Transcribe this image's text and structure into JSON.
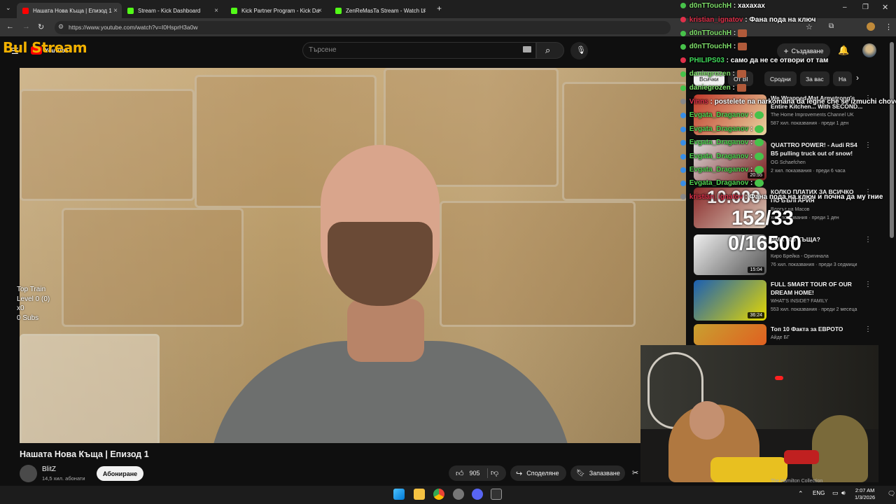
{
  "browser": {
    "tabs": [
      {
        "label": "Нашата Нова Къща | Епизод 1",
        "icon_color": "#ff0000"
      },
      {
        "label": "Stream - Kick Dashboard",
        "icon_color": "#53fc18"
      },
      {
        "label": "Kick Partner Program - Kick Da",
        "icon_color": "#53fc18"
      },
      {
        "label": "ZenReMasTa Stream - Watch Li",
        "icon_color": "#53fc18"
      }
    ],
    "url": "https://www.youtube.com/watch?v=I0HsprH3a0w"
  },
  "youtube": {
    "logo_overlay": "Bul  Stream",
    "logo_word": "YouTube",
    "search_placeholder": "Търсене",
    "create_label": "Създаване",
    "video": {
      "title": "Нашата Нова Къща | Епизод 1",
      "channel": "BlitZ",
      "subscribers": "14,5 хил. абонати",
      "subscribe_label": "Абониране",
      "likes": "905",
      "share_label": "Споделяне",
      "save_label": "Запазване"
    },
    "chips": [
      "Всички",
      "От Bl",
      "Сродни",
      "За вас",
      "На"
    ],
    "recommendations": [
      {
        "title": "We Wrapped Mat Armstrong's Entire Kitchen... With SECOND...",
        "channel": "The Home Improvements Channel UK",
        "meta": "587 хил. показвания · преди 1 ден",
        "duration": ""
      },
      {
        "title": "QUATTRO POWER! - Audi RS4 B5 pulling truck out of snow!",
        "channel": "OG Schaefchen",
        "meta": "2 хил. показвания · преди 6 часа",
        "duration": "20:55"
      },
      {
        "title": "КОЛКО ПЛАТИХ ЗА ВСИЧКО ПО БЪЛГАРИЯ",
        "channel": "Влогът на Масов",
        "meta": "хил. показвания · преди 1 ден",
        "duration": ""
      },
      {
        "title": "ИМА 800 КЪЩА?",
        "channel": "Киро Брейка - Оригинала",
        "meta": "76 хил. показвания · преди 3 седмици",
        "duration": "15:04"
      },
      {
        "title": "FULL SMART TOUR OF OUR DREAM HOME!",
        "channel": "WHAT'S INSIDE? FAMILY",
        "meta": "553 хил. показвания · преди 2 месеца",
        "duration": "36:24"
      },
      {
        "title": "Топ 10 Факта за ЕВРОТО",
        "channel": "Айде БГ",
        "meta": "",
        "duration": ""
      }
    ],
    "bottom_channel": "The Hamilton Collection"
  },
  "stream_overlay": {
    "top_train": [
      "Top Train",
      "Level 0  (0)",
      "x0",
      "0 Subs"
    ],
    "stats": [
      "10.000",
      "152/33",
      "0/16500"
    ],
    "chat": [
      {
        "user": "d0nTTouchH",
        "msg": "хахахах",
        "color": "#7fe06a"
      },
      {
        "user": "kristian_ignatov",
        "msg": "Фана пода на ключ",
        "color": "#e0304a"
      },
      {
        "user": "d0nTTouchH",
        "msg": "",
        "color": "#7fe06a"
      },
      {
        "user": "d0nTTouchH",
        "msg": "",
        "color": "#7fe06a"
      },
      {
        "user": "PHILIPS03",
        "msg": "само да не се отвори от там",
        "color": "#3fdc5a"
      },
      {
        "user": "daniegrozen",
        "msg": "",
        "color": "#7fe06a"
      },
      {
        "user": "daniegrozen",
        "msg": "",
        "color": "#7fe06a"
      },
      {
        "user": "Vinns",
        "msg": "postelete na narkomana da legne che se izmuchi chove",
        "color": "#e0304a"
      },
      {
        "user": "Evgata_Draganov",
        "msg": "",
        "color": "#52d652"
      },
      {
        "user": "Evgata_Draganov",
        "msg": "",
        "color": "#52d652"
      },
      {
        "user": "Evgata_Draganov",
        "msg": "",
        "color": "#52d652"
      },
      {
        "user": "Evgata_Draganov",
        "msg": "",
        "color": "#52d652"
      },
      {
        "user": "Evgata_Draganov",
        "msg": "",
        "color": "#52d652"
      },
      {
        "user": "Evgata_Draganov",
        "msg": "",
        "color": "#52d652"
      },
      {
        "user": "kristian_ignatov",
        "msg": "Фана пода на ключ и почна да му гние",
        "color": "#e0304a"
      }
    ]
  },
  "taskbar": {
    "lang": "ENG",
    "time": "2:07 AM",
    "date": "1/3/2026"
  }
}
